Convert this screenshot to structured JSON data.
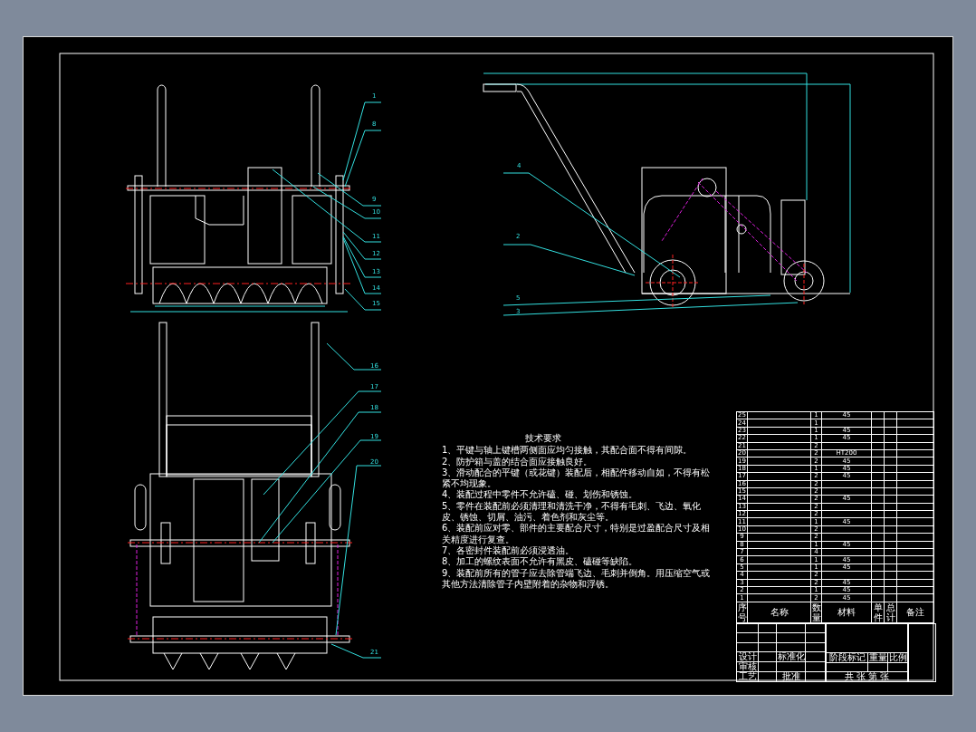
{
  "front_view": {
    "callouts": [
      "1",
      "8",
      "9",
      "10",
      "11",
      "12",
      "13",
      "14",
      "15"
    ]
  },
  "side_view": {
    "callouts": [
      "4",
      "2",
      "5",
      "3"
    ]
  },
  "bottom_view": {
    "callouts": [
      "16",
      "17",
      "18",
      "19",
      "20",
      "21"
    ]
  },
  "technical_requirements": {
    "title": "技术要求",
    "items": [
      "1、平键与轴上键槽两侧面应均匀接触，其配合面不得有间隙。",
      "2、防护箱与盖的结合面应接触良好。",
      "3、滑动配合的平键（或花键）装配后，相配件移动自如，不得有松紧不均现象。",
      "4、装配过程中零件不允许磕、碰、划伤和锈蚀。",
      "5、零件在装配前必须清理和清洗干净，不得有毛刺、飞边、氧化皮、锈蚀、切屑、油污、着色剂和灰尘等。",
      "6、装配前应对零、部件的主要配合尺寸，特别是过盈配合尺寸及相关精度进行复查。",
      "7、各密封件装配前必须浸透油。",
      "8、加工的螺纹表面不允许有黑皮、磕碰等缺陷。",
      "9、装配前所有的管子应去除管端飞边、毛刺并倒角。用压缩空气或其他方法清除管子内壁附着的杂物和浮锈。"
    ]
  },
  "parts_list": {
    "columns": [
      "序号",
      "名称",
      "数量",
      "材料",
      "单件",
      "总计",
      "备注"
    ],
    "rows": [
      {
        "no": "25",
        "qty": "1",
        "material": "45"
      },
      {
        "no": "24",
        "qty": "1"
      },
      {
        "no": "23",
        "qty": "1",
        "material": "45"
      },
      {
        "no": "22",
        "qty": "1",
        "material": "45"
      },
      {
        "no": "21",
        "qty": "2"
      },
      {
        "no": "20",
        "qty": "2",
        "material": "HT200"
      },
      {
        "no": "19",
        "qty": "2",
        "material": "45"
      },
      {
        "no": "18",
        "qty": "1",
        "material": "45"
      },
      {
        "no": "17",
        "qty": "2",
        "material": "45"
      },
      {
        "no": "16",
        "qty": "2"
      },
      {
        "no": "15",
        "qty": "2"
      },
      {
        "no": "14",
        "qty": "2",
        "material": "45"
      },
      {
        "no": "13",
        "qty": "2"
      },
      {
        "no": "12",
        "qty": "2"
      },
      {
        "no": "11",
        "qty": "1",
        "material": "45"
      },
      {
        "no": "10",
        "qty": "2"
      },
      {
        "no": "9",
        "qty": "2"
      },
      {
        "no": "8",
        "qty": "1",
        "material": "45"
      },
      {
        "no": "7",
        "qty": "4"
      },
      {
        "no": "6",
        "qty": "1",
        "material": "45"
      },
      {
        "no": "5",
        "qty": "1",
        "material": "45"
      },
      {
        "no": "4",
        "qty": "2"
      },
      {
        "no": "3",
        "qty": "2",
        "material": "45"
      },
      {
        "no": "2",
        "qty": "1",
        "material": "45"
      },
      {
        "no": "1",
        "qty": "2",
        "material": "45"
      }
    ]
  },
  "title_block": {
    "design_label": "设计",
    "standardization_label": "标准化",
    "review_label": "审核",
    "process_label": "工艺",
    "approval_label": "批准",
    "stage_label": "阶段标记",
    "weight_label": "重量",
    "scale_label": "比例",
    "sheet_label": "共 张 第 张"
  }
}
